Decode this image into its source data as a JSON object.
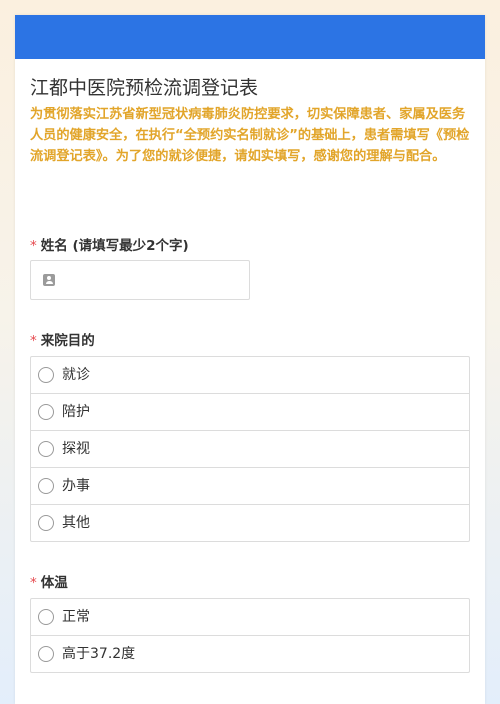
{
  "form": {
    "title": "江都中医院预检流调登记表",
    "description": "为贯彻落实江苏省新型冠状病毒肺炎防控要求，切实保障患者、家属及医务人员的健康安全，在执行“全预约实名制就诊”的基础上，患者需填写《预检流调登记表》。为了您的就诊便捷，请如实填写，感谢您的理解与配合。",
    "required_mark": "*",
    "colors": {
      "banner": "#2c74e4",
      "description": "#e2a52a",
      "required": "#e5484d"
    }
  },
  "questions": {
    "name": {
      "label": "姓名 (请填写最少2个字)",
      "value": "",
      "icon": "user-icon"
    },
    "purpose": {
      "label": "来院目的",
      "options": [
        "就诊",
        "陪护",
        "探视",
        "办事",
        "其他"
      ]
    },
    "temperature": {
      "label": "体温",
      "options": [
        "正常",
        "高于37.2度"
      ]
    }
  }
}
